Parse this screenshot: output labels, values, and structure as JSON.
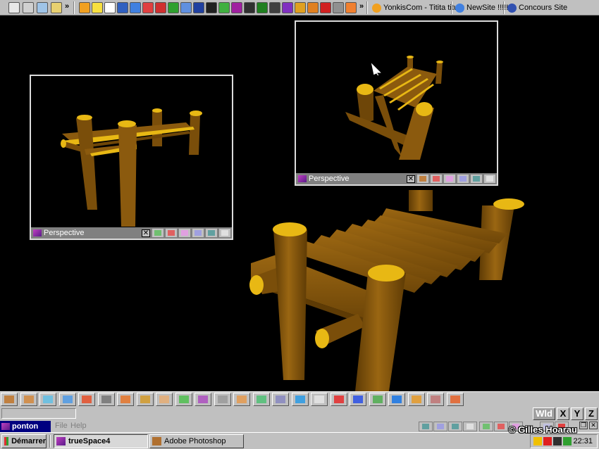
{
  "top_taskbar": {
    "quick_launch_icons": [
      "desktop-icon",
      "minimize-icon",
      "explorer-icon",
      "folder-icon",
      "more-icon"
    ],
    "toolbar_icons": [
      "agent-icon",
      "warning-icon",
      "runner-icon",
      "word-icon",
      "ie-icon",
      "lifebuoy-icon",
      "ring-icon",
      "x-icon",
      "package-icon",
      "person-icon",
      "face-icon",
      "paint-icon",
      "media-icon",
      "globe-icon",
      "film-icon",
      "truespace-icon",
      "pencil-icon",
      "brush-icon",
      "acrobat-icon",
      "calculator-icon",
      "fire-icon"
    ],
    "windows": [
      {
        "label": "YonkisCom - Titita titutu",
        "icon": "flower-icon"
      },
      {
        "label": "NewSite !!!!!",
        "icon": "ie-icon"
      },
      {
        "label": "Concours Site",
        "icon": "w-icon"
      }
    ]
  },
  "viewports": [
    {
      "title": "Perspective",
      "close_label": "✕"
    },
    {
      "title": "Perspective",
      "close_label": "✕"
    }
  ],
  "bottom_toolbar": {
    "tools": [
      "object-tool",
      "cube-tool",
      "nav-tool",
      "select-arrow-tool",
      "scale-tool",
      "move-down-tool",
      "box-tool",
      "texture-tool",
      "sphere-tool",
      "color-tool",
      "group-tool",
      "deform-tool",
      "brush-tool",
      "library-tool",
      "list-tool",
      "cube-blue-tool",
      "person-tool",
      "axes-tool",
      "grid-tool",
      "landscape-tool",
      "3d-tool",
      "pen-tool",
      "rotate-tool",
      "pointer-tool"
    ]
  },
  "axis_buttons": {
    "wld": "Wld",
    "x": "X",
    "y": "Y",
    "z": "Z"
  },
  "menu": {
    "app_title": "ponton",
    "file": "File",
    "help": "Help"
  },
  "copyright": "© Gilles Hoarau",
  "taskbar": {
    "start": "Démarrer",
    "tasks": [
      "trueSpace4",
      "Adobe Photoshop"
    ],
    "clock": "22:31"
  },
  "colors": {
    "wood": "#8b5a0e",
    "wood_dark": "#5e3b05",
    "wood_top": "#e8b814",
    "background": "#000000",
    "chrome": "#c0c0c0"
  }
}
